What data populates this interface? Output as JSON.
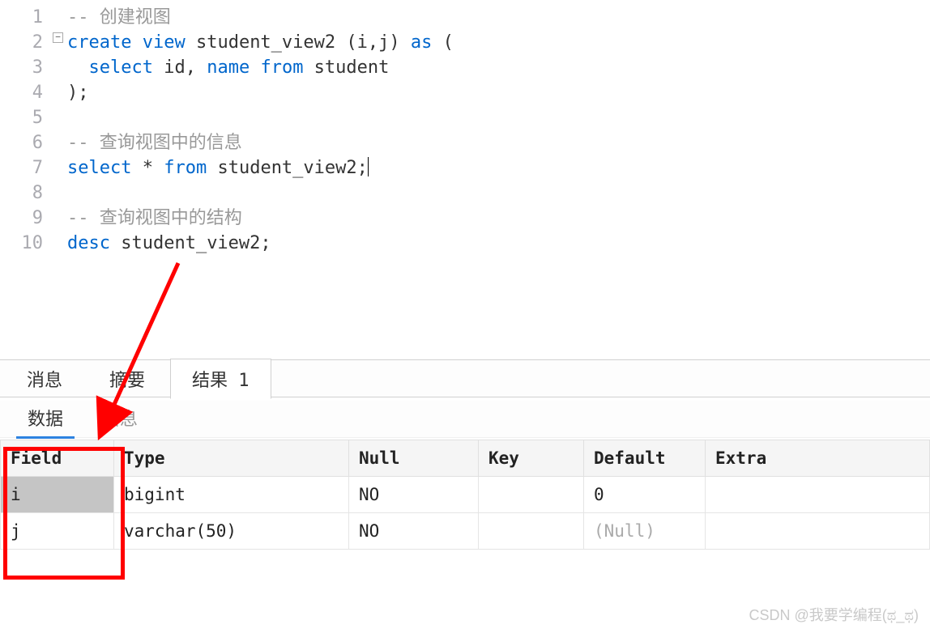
{
  "editor": {
    "lines": [
      "1",
      "2",
      "3",
      "4",
      "5",
      "6",
      "7",
      "8",
      "9",
      "10"
    ],
    "code": {
      "l1": {
        "cm": "-- 创建视图"
      },
      "l2": {
        "kw1": "create",
        "kw2": "view",
        "t1": " student_view2 (i,j) ",
        "kw3": "as",
        "t2": " ("
      },
      "l3": {
        "kw1": "select",
        "t1": " id, ",
        "kw2": "name",
        "t2": " ",
        "kw3": "from",
        "t3": " student"
      },
      "l4": {
        "t": ");"
      },
      "l6": {
        "cm": "-- 查询视图中的信息"
      },
      "l7": {
        "kw1": "select",
        "t1": " * ",
        "kw2": "from",
        "t2": " student_view2;"
      },
      "l9": {
        "cm": "-- 查询视图中的结构"
      },
      "l10": {
        "kw1": "desc",
        "t1": " student_view2;"
      }
    }
  },
  "tabs": {
    "messages": "消息",
    "summary": "摘要",
    "result": "结果 1"
  },
  "subtabs": {
    "data": "数据",
    "info": "信息"
  },
  "table": {
    "headers": {
      "field": "Field",
      "type": "Type",
      "null": "Null",
      "key": "Key",
      "default": "Default",
      "extra": "Extra"
    },
    "rows": [
      {
        "field": "i",
        "type": "bigint",
        "null": "NO",
        "key": "",
        "default": "0",
        "extra": ""
      },
      {
        "field": "j",
        "type": "varchar(50)",
        "null": "NO",
        "key": "",
        "default": "(Null)",
        "extra": "",
        "nullish": true
      }
    ]
  },
  "watermark": "CSDN @我要学编程(ಥ_ಥ)"
}
